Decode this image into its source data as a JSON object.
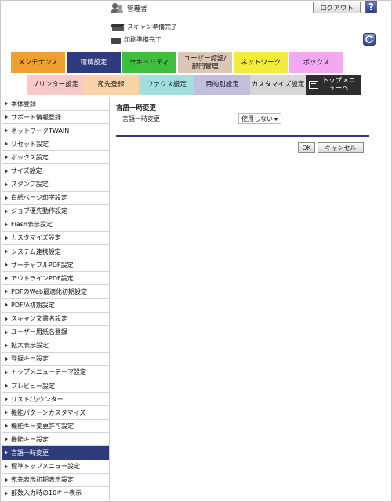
{
  "header": {
    "user_label": "管理者",
    "logout_label": "ログアウト",
    "help_label": "?",
    "scan_status": "スキャン準備完了",
    "print_status": "印刷準備完了"
  },
  "tabs_row1": [
    {
      "label": "メンテナンス",
      "color": "#f0a030"
    },
    {
      "label": "環境設定",
      "color": "#2e3b7c",
      "active": true
    },
    {
      "label": "セキュリティ",
      "color": "#3fbf3f"
    },
    {
      "label": "ユーザー認証/部門管理",
      "color": "#dcc7b6"
    },
    {
      "label": "ネットワーク",
      "color": "#f3ec3c"
    },
    {
      "label": "ボックス",
      "color": "#f2a9f2"
    }
  ],
  "tabs_row2": [
    {
      "label": "プリンター設定",
      "color": "#f7c9c9"
    },
    {
      "label": "宛先登録",
      "color": "#fbd3a8"
    },
    {
      "label": "ファクス設定",
      "color": "#a4dfe0"
    },
    {
      "label": "目的別設定",
      "color": "#c4bede"
    },
    {
      "label": "カスタマイズ設定",
      "color": "#d7d7d7"
    },
    {
      "label": "トップメニューへ",
      "color": "#2d2d2d",
      "dark": true
    }
  ],
  "sidebar": {
    "items": [
      "本体登録",
      "サポート情報登録",
      "ネットワークTWAIN",
      "リセット設定",
      "ボックス設定",
      "サイズ設定",
      "スタンプ設定",
      "白紙ページ印字設定",
      "ジョブ優先動作設定",
      "Flash表示設定",
      "カスタマイズ設定",
      "システム連携設定",
      "サーチャブルPDF設定",
      "アウトラインPDF設定",
      "PDFのWeb最適化初期設定",
      "PDF/A初期設定",
      "スキャン文書名設定",
      "ユーザー用紙名登録",
      "拡大表示設定",
      "登録キー設定",
      "トップメニューテーマ設定",
      "プレビュー設定",
      "リスト/カウンター",
      "機能パターンカスタマイズ",
      "機能キー変更許可設定",
      "機能キー設定",
      "言語一時変更",
      "標準トップメニュー設定",
      "宛先表示初期表示設定",
      "部数入力時の10キー表示"
    ],
    "active_index": 26
  },
  "main": {
    "title": "言語一時変更",
    "field_label": "言語一時変更",
    "select_value": "使用しない",
    "ok_label": "OK",
    "cancel_label": "キャンセル"
  }
}
